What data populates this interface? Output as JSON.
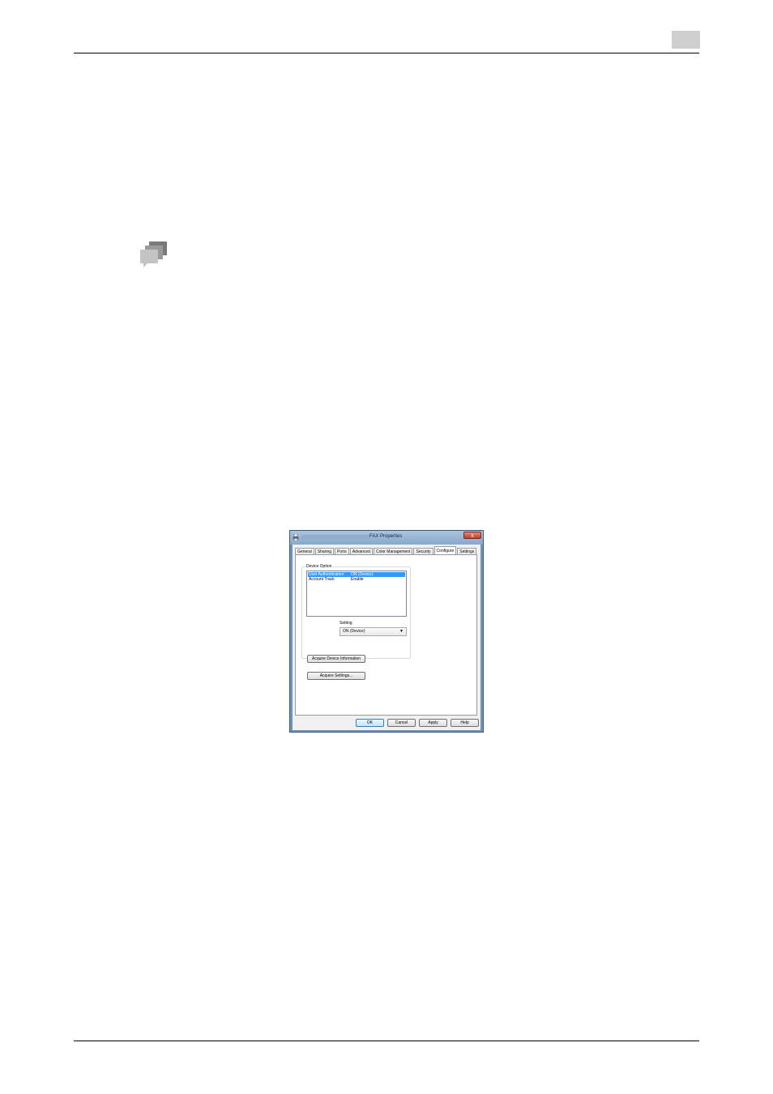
{
  "dialog": {
    "title": "FAX Properties",
    "close_label": "x",
    "tabs": [
      "General",
      "Sharing",
      "Ports",
      "Advanced",
      "Color Management",
      "Security",
      "Configure",
      "Settings"
    ],
    "active_tab": "Configure",
    "device_option": {
      "label": "Device Option",
      "rows": [
        {
          "option": "User Authentication",
          "value": "ON (Device)",
          "selected": true
        },
        {
          "option": "Account Track",
          "value": "Enable",
          "selected": false
        }
      ]
    },
    "setting": {
      "label": "Setting",
      "value": "ON (Device)"
    },
    "acquire_device_info_label": "Acquire Device Information",
    "acquire_settings_label": "Acquire Settings...",
    "footer": {
      "ok": "OK",
      "cancel": "Cancel",
      "apply": "Apply",
      "help": "Help"
    }
  },
  "colors": {
    "selection": "#3399ff",
    "titlebar": "#86a9cd",
    "close": "#c0402c"
  },
  "icons": [
    "tips-icon",
    "printer-icon",
    "dropdown-arrow-icon"
  ]
}
